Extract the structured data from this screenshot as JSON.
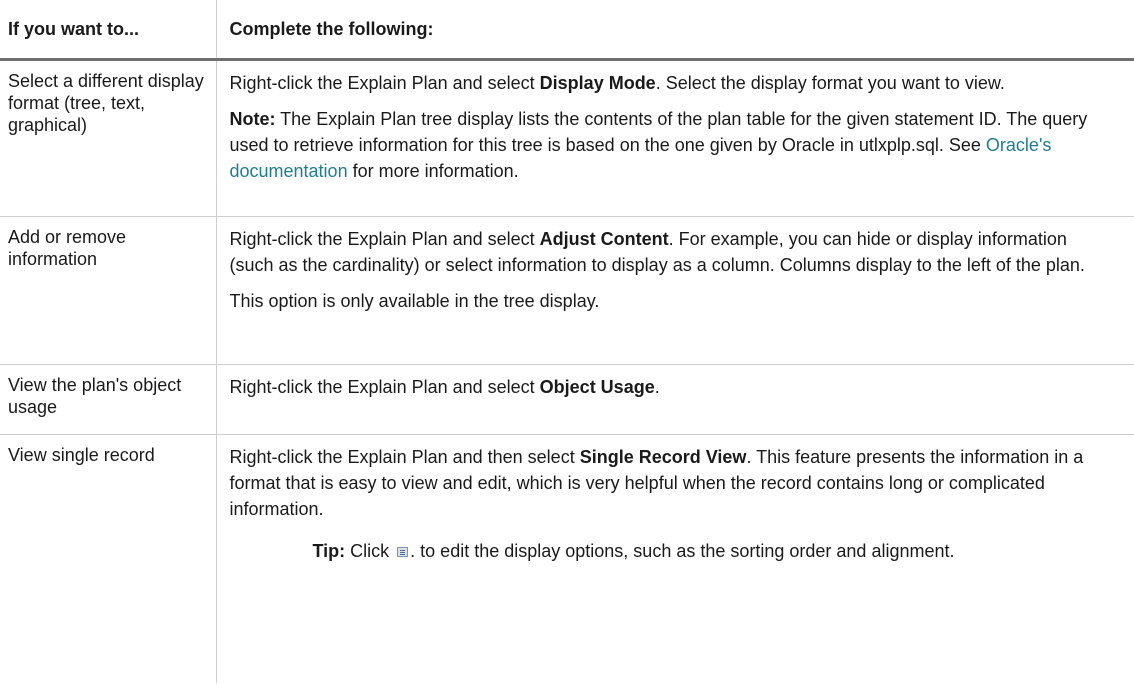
{
  "header": {
    "col1": "If you want to...",
    "col2": "Complete the following:"
  },
  "rows": [
    {
      "left": "Select a different display format (tree, text, graphical)",
      "p1": {
        "pre": "Right-click the Explain Plan and select ",
        "bold": "Display Mode",
        "post": ". Select the display format you want to view."
      },
      "p2": {
        "note_label": "Note:",
        "pre": " The Explain Plan tree display lists the contents of the plan table for the given statement ID. The query used to retrieve information for this tree is based on the one given by Oracle in utlxplp.sql. See ",
        "link": "Oracle's documentation",
        "post": " for more information."
      }
    },
    {
      "left": "Add or remove information",
      "p1": {
        "pre": "Right-click the Explain Plan and select ",
        "bold": "Adjust Content",
        "post": ". For example, you can hide or display information (such as the cardinality) or select information to display as a column. Columns display to the left of the plan."
      },
      "p2": {
        "text": "This option is only available in the tree display."
      }
    },
    {
      "left": "View the plan's object usage",
      "p1": {
        "pre": "Right-click the Explain Plan and select ",
        "bold": "Object Usage",
        "post": "."
      }
    },
    {
      "left": "View single record",
      "p1": {
        "pre": "Right-click the Explain Plan and then select ",
        "bold": "Single Record View",
        "post": ". This feature presents the information in a format that is easy to view and edit, which is very helpful when the record contains long or complicated information."
      },
      "tip": {
        "label": "Tip:",
        "pre": " Click ",
        "icon": "display-options-icon",
        "post": ". to edit the display options, such as the sorting order and alignment."
      }
    }
  ]
}
